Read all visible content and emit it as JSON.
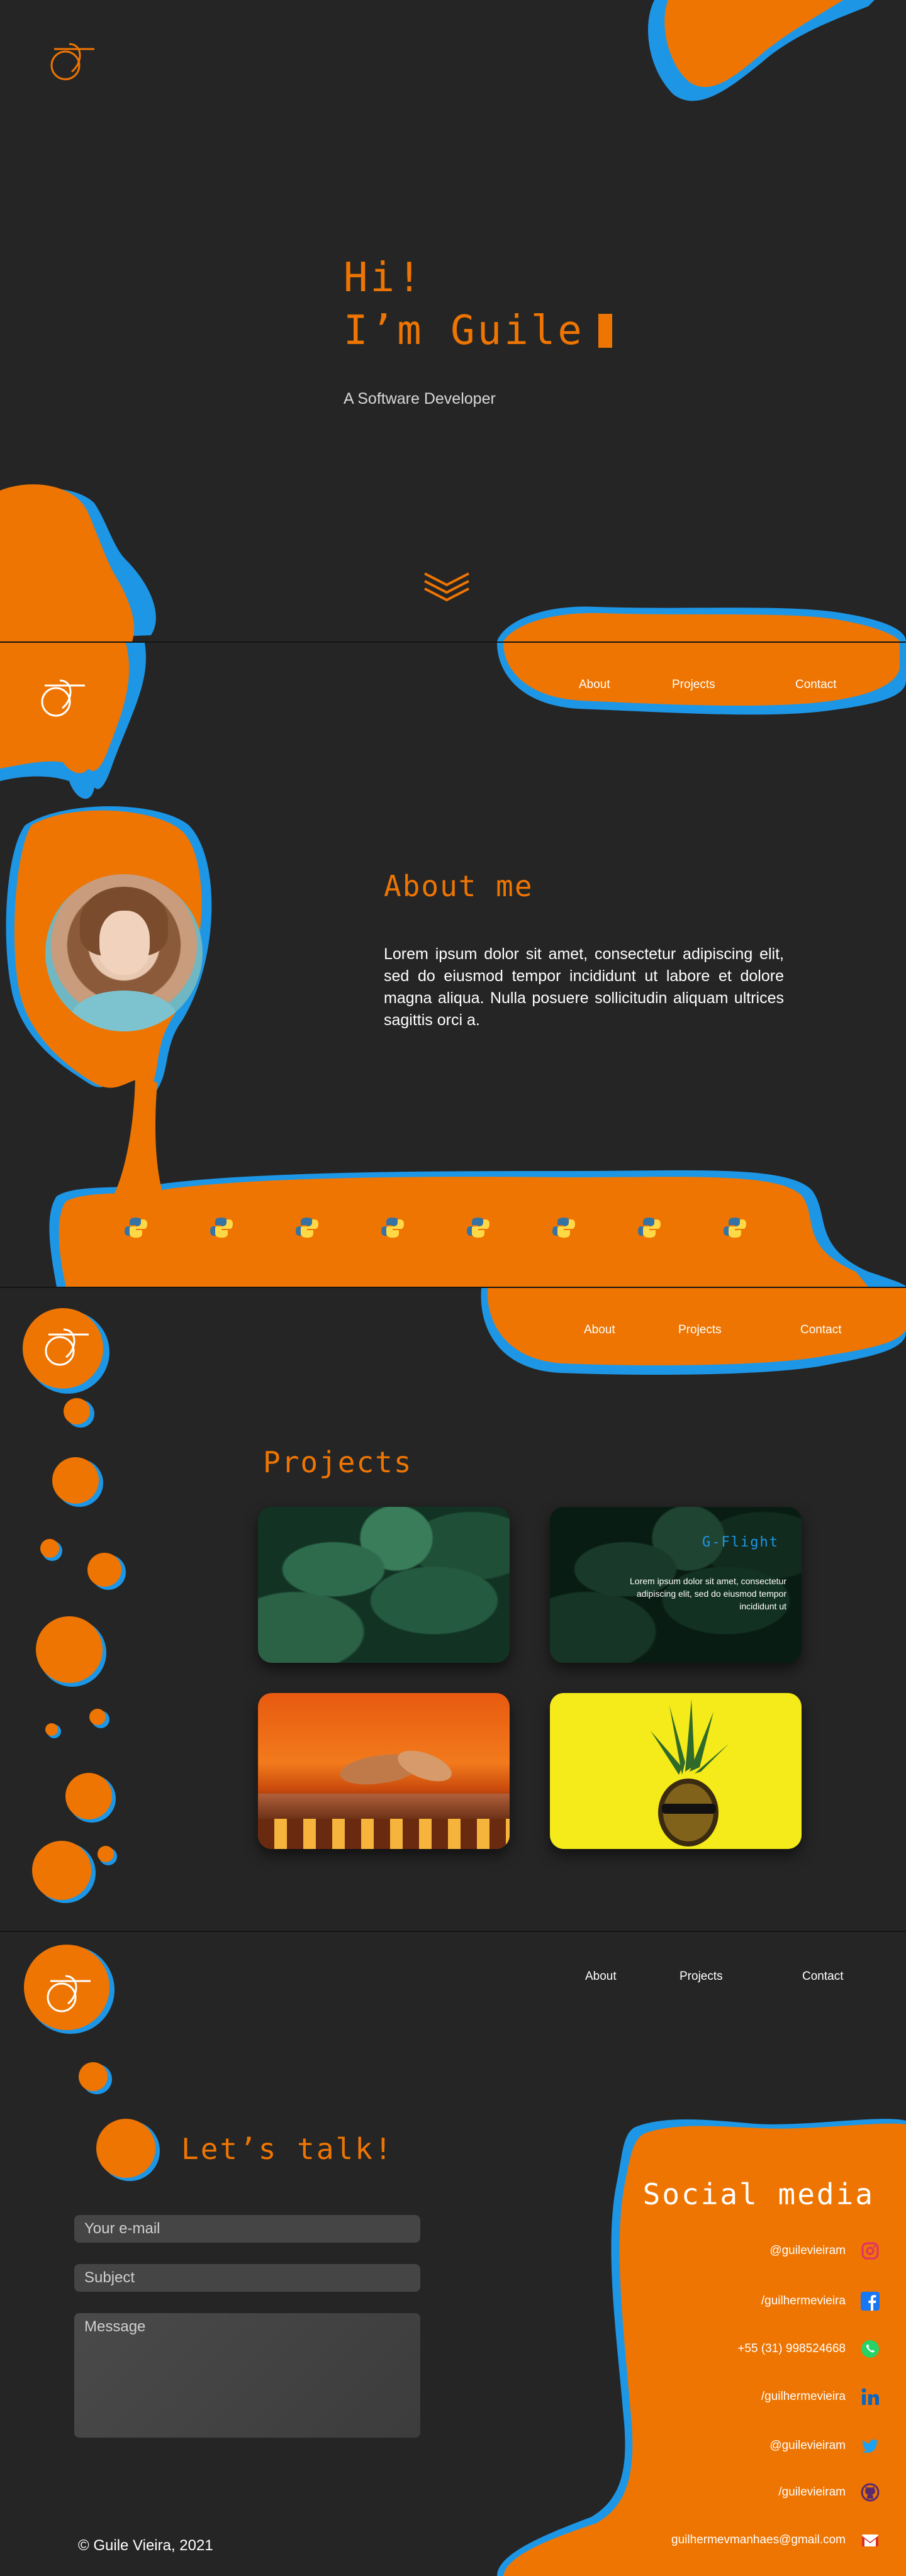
{
  "hero": {
    "line1": "Hi!",
    "line2": "I’m Guile",
    "subtitle": "A Software Developer"
  },
  "nav": {
    "about": "About",
    "projects": "Projects",
    "contact": "Contact"
  },
  "about": {
    "title": "About me",
    "body": "Lorem ipsum dolor sit amet, consectetur adipiscing elit, sed do eiusmod tempor incididunt ut labore et dolore magna aliqua. Nulla posuere sollicitudin aliquam ultrices sagittis orci a.",
    "skill_icons": [
      "python-icon",
      "python-icon",
      "python-icon",
      "python-icon",
      "python-icon",
      "python-icon",
      "python-icon",
      "python-icon"
    ]
  },
  "projects": {
    "title": "Projects",
    "cards": [
      {
        "image": "leaves-photo",
        "title": "",
        "text": ""
      },
      {
        "image": "leaves-photo",
        "title": "G-Flight",
        "text": "Lorem ipsum dolor sit amet, consectetur adipiscing elit, sed do eiusmod tempor incididunt ut"
      },
      {
        "image": "squirrel-photo",
        "title": "",
        "text": ""
      },
      {
        "image": "pineapple-photo",
        "title": "",
        "text": ""
      }
    ]
  },
  "contact": {
    "title": "Let’s talk!",
    "email_placeholder": "Your e-mail",
    "subject_placeholder": "Subject",
    "message_placeholder": "Message",
    "social_title": "Social media",
    "socials": [
      {
        "text": "@guilevieiram",
        "icon": "instagram-icon"
      },
      {
        "text": "/guilhermevieira",
        "icon": "facebook-icon"
      },
      {
        "text": "+55 (31) 998524668",
        "icon": "whatsapp-icon"
      },
      {
        "text": "/guilhermevieira",
        "icon": "linkedin-icon"
      },
      {
        "text": "@guilevieiram",
        "icon": "twitter-icon"
      },
      {
        "text": "/guilevieiram",
        "icon": "github-icon"
      },
      {
        "text": "guilhermevmanhaes@gmail.com",
        "icon": "gmail-icon"
      }
    ],
    "footer": "© Guile Vieira, 2021"
  },
  "colors": {
    "background": "#252525",
    "orange": "#EE7502",
    "blue": "#1E96E6"
  }
}
